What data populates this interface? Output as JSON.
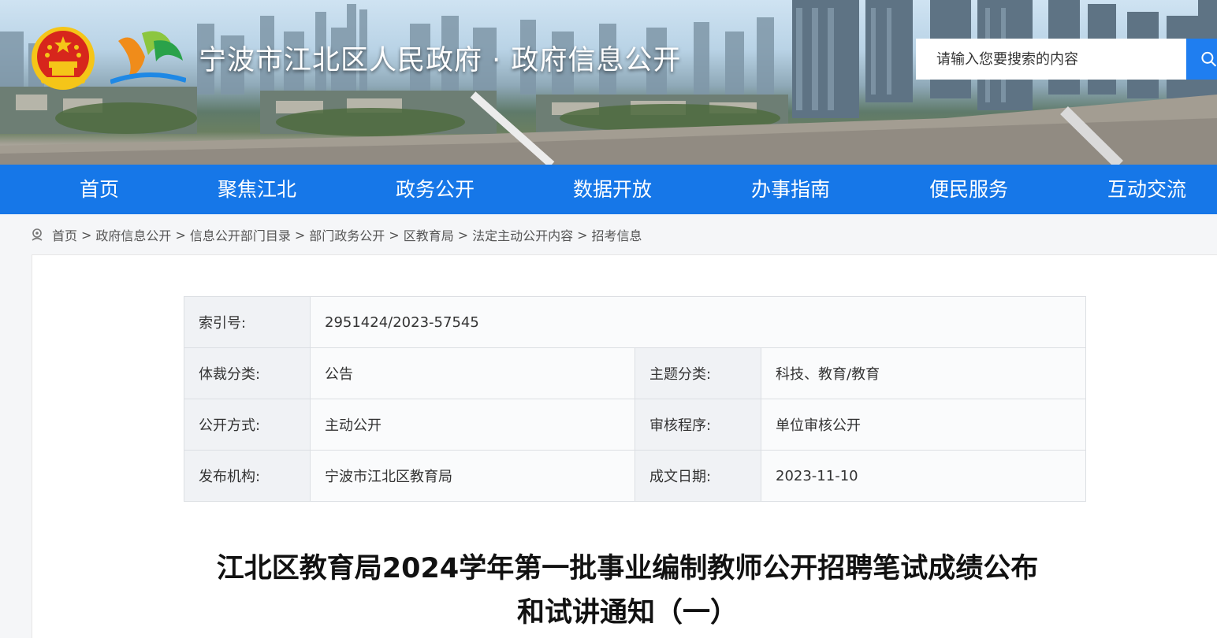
{
  "header": {
    "site_title": "宁波市江北区人民政府 · 政府信息公开",
    "search_placeholder": "请输入您要搜索的内容",
    "emblem_icon": "national-emblem-icon",
    "brand_icon": "jiangbei-logo-icon",
    "search_icon": "search-icon"
  },
  "nav": {
    "items": [
      "首页",
      "聚焦江北",
      "政务公开",
      "数据开放",
      "办事指南",
      "便民服务",
      "互动交流"
    ]
  },
  "breadcrumb": {
    "items": [
      "首页",
      "政府信息公开",
      "信息公开部门目录",
      "部门政务公开",
      "区教育局",
      "法定主动公开内容",
      "招考信息"
    ],
    "separator": ">"
  },
  "meta": {
    "index_label": "索引号:",
    "index_value": "2951424/2023-57545",
    "genre_label": "体裁分类:",
    "genre_value": "公告",
    "topic_label": "主题分类:",
    "topic_value": "科技、教育/教育",
    "method_label": "公开方式:",
    "method_value": "主动公开",
    "review_label": "审核程序:",
    "review_value": "单位审核公开",
    "publisher_label": "发布机构:",
    "publisher_value": "宁波市江北区教育局",
    "date_label": "成文日期:",
    "date_value": "2023-11-10"
  },
  "article": {
    "title_line1": "江北区教育局2024学年第一批事业编制教师公开招聘笔试成绩公布",
    "title_line2": "和试讲通知（一）"
  },
  "colors": {
    "nav_blue": "#1677e8",
    "search_button": "#1f7ef0",
    "emblem_red": "#d7261c",
    "emblem_gold": "#f5c518"
  }
}
